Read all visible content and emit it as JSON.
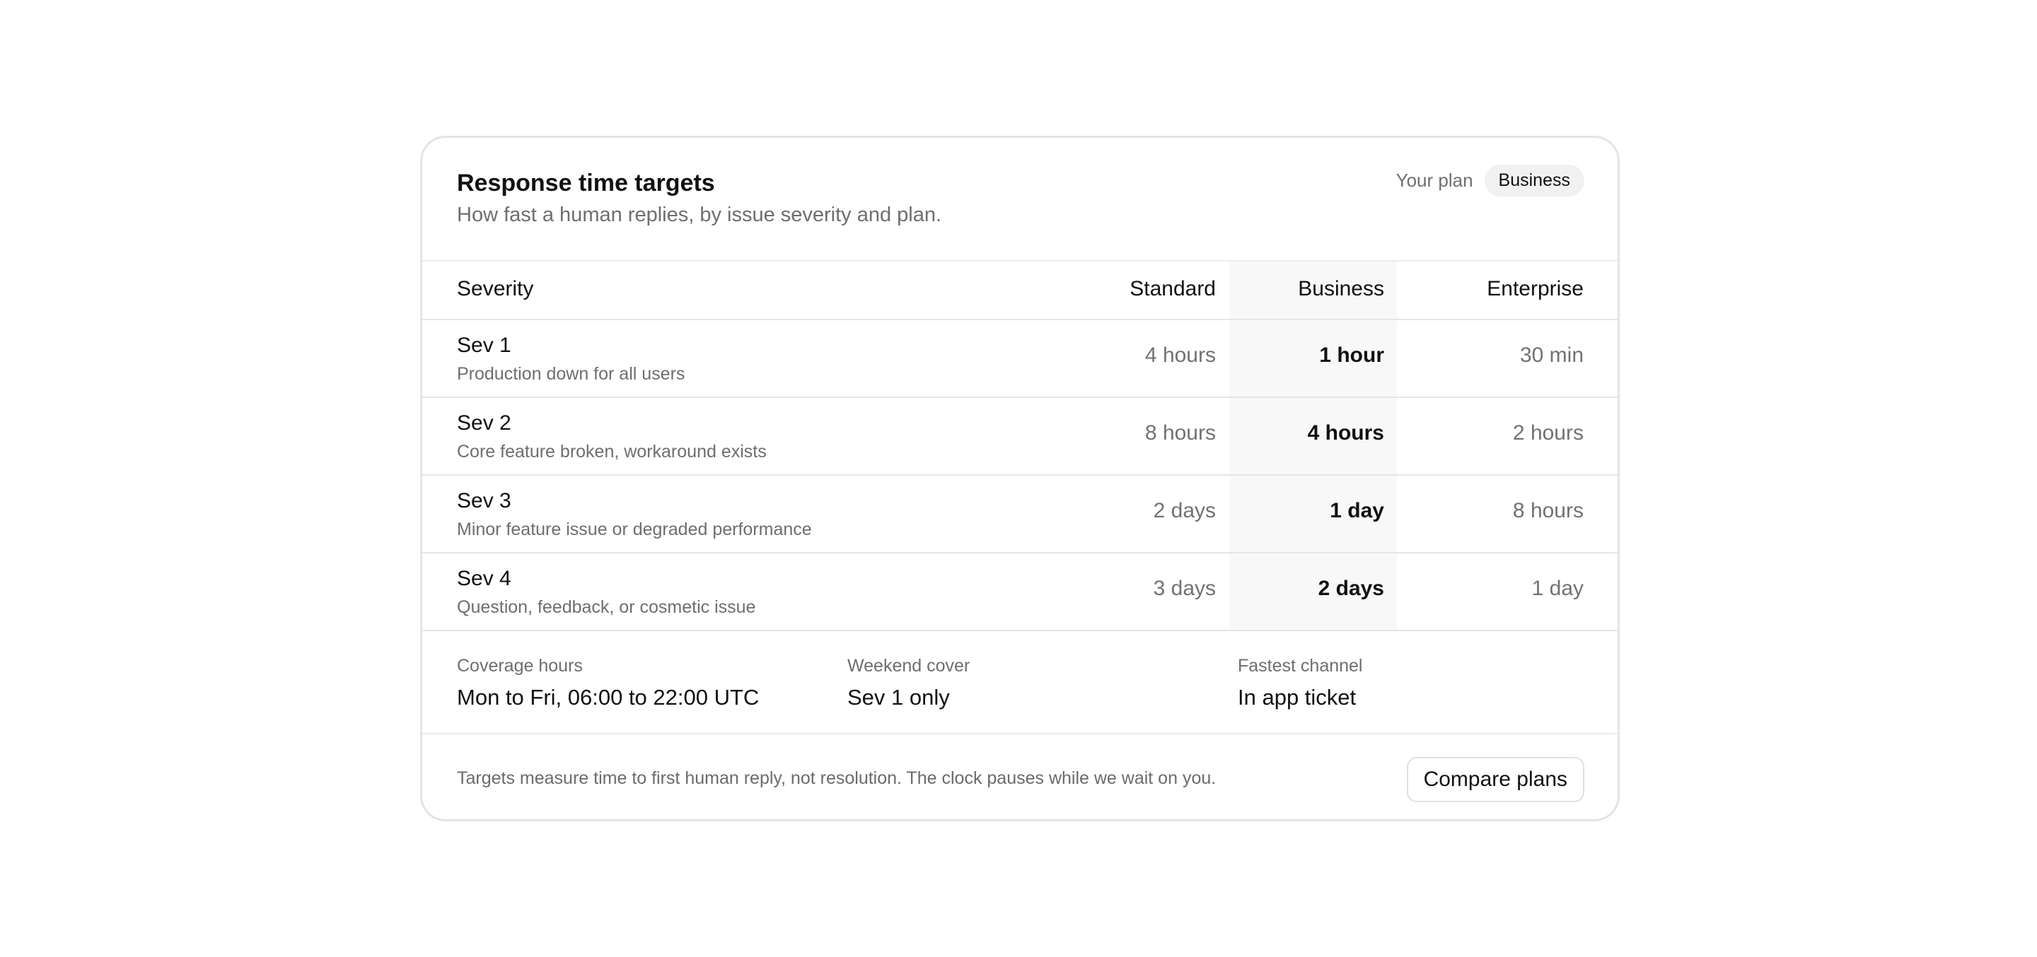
{
  "card": {
    "title": "Response time targets",
    "subtitle": "How fast a human replies, by issue severity and plan.",
    "plan_label": "Your plan",
    "plan_value": "Business"
  },
  "table": {
    "headers": [
      "Severity",
      "Standard",
      "Business",
      "Enterprise"
    ],
    "highlighted_plan": "Business",
    "rows": [
      {
        "name": "Sev 1",
        "description": "Production down for all users",
        "standard": "4 hours",
        "business": "1 hour",
        "enterprise": "30 min"
      },
      {
        "name": "Sev 2",
        "description": "Core feature broken, workaround exists",
        "standard": "8 hours",
        "business": "4 hours",
        "enterprise": "2 hours"
      },
      {
        "name": "Sev 3",
        "description": "Minor feature issue or degraded performance",
        "standard": "2 days",
        "business": "1 day",
        "enterprise": "8 hours"
      },
      {
        "name": "Sev 4",
        "description": "Question, feedback, or cosmetic issue",
        "standard": "3 days",
        "business": "2 days",
        "enterprise": "1 day"
      }
    ]
  },
  "meta": [
    {
      "label": "Coverage hours",
      "value": "Mon to Fri, 06:00 to 22:00 UTC"
    },
    {
      "label": "Weekend cover",
      "value": "Sev 1 only"
    },
    {
      "label": "Fastest channel",
      "value": "In app ticket"
    }
  ],
  "footer": {
    "note": "Targets measure time to first human reply, not resolution. The clock pauses while we wait on you.",
    "button_label": "Compare plans"
  },
  "colors": {
    "border": "#e4e4e4",
    "highlight_column": "#f8f8f8",
    "badge_background": "#f1f1f1",
    "muted_text": "#6e6e6e",
    "primary_text": "#111111"
  }
}
